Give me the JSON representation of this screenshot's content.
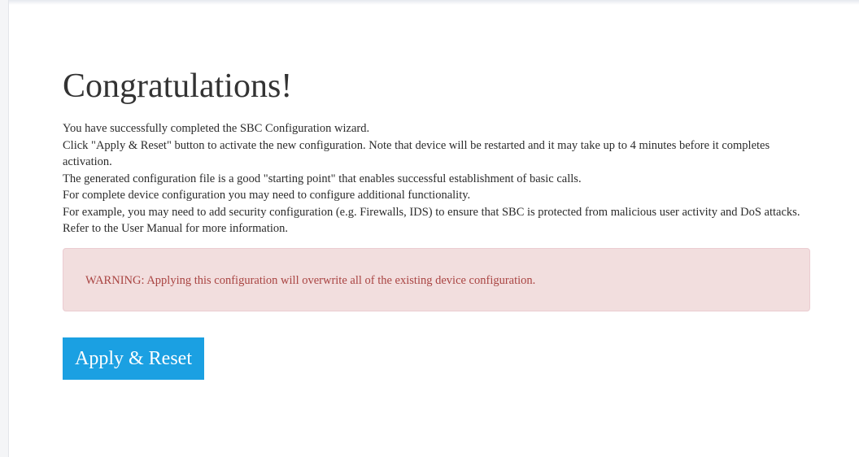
{
  "page": {
    "title": "Congratulations!",
    "paragraphs": [
      "You have successfully completed the SBC Configuration wizard.",
      "Click \"Apply & Reset\" button to activate the new configuration. Note that device will be restarted and it may take up to 4 minutes before it completes activation.",
      "The generated configuration file is a good \"starting point\" that enables successful establishment of basic calls.",
      "For complete device configuration you may need to configure additional functionality.",
      "For example, you may need to add security configuration (e.g. Firewalls, IDS) to ensure that SBC is protected from malicious user activity and DoS attacks.",
      "Refer to the User Manual for more information."
    ],
    "warning": "WARNING: Applying this configuration will overwrite all of the existing device configuration.",
    "apply_button_label": "Apply & Reset"
  },
  "colors": {
    "warning_background": "#f2dede",
    "warning_text": "#a94442",
    "button_background": "#1ba0e2",
    "button_text": "#ffffff"
  }
}
